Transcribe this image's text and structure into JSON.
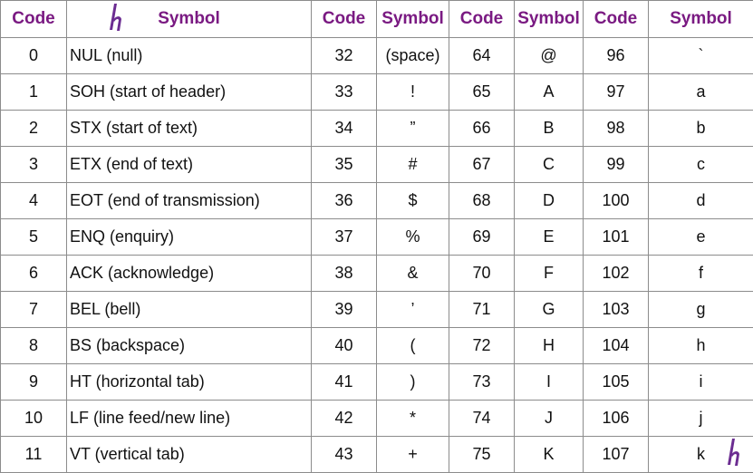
{
  "headers": [
    "Code",
    "Symbol",
    "Code",
    "Symbol",
    "Code",
    "Symbol",
    "Code",
    "Symbol"
  ],
  "rows": [
    [
      "0",
      "NUL (null)",
      "32",
      "(space)",
      "64",
      "@",
      "96",
      "`"
    ],
    [
      "1",
      "SOH (start of header)",
      "33",
      "!",
      "65",
      "A",
      "97",
      "a"
    ],
    [
      "2",
      "STX (start of text)",
      "34",
      "”",
      "66",
      "B",
      "98",
      "b"
    ],
    [
      "3",
      "ETX (end of text)",
      "35",
      "#",
      "67",
      "C",
      "99",
      "c"
    ],
    [
      "4",
      "EOT (end of transmission)",
      "36",
      "$",
      "68",
      "D",
      "100",
      "d"
    ],
    [
      "5",
      "ENQ (enquiry)",
      "37",
      "%",
      "69",
      "E",
      "101",
      "e"
    ],
    [
      "6",
      "ACK (acknowledge)",
      "38",
      "&",
      "70",
      "F",
      "102",
      "f"
    ],
    [
      "7",
      "BEL (bell)",
      "39",
      "’",
      "71",
      "G",
      "103",
      "g"
    ],
    [
      "8",
      "BS (backspace)",
      "40",
      "(",
      "72",
      "H",
      "104",
      "h"
    ],
    [
      "9",
      "HT (horizontal tab)",
      "41",
      ")",
      "73",
      "I",
      "105",
      "i"
    ],
    [
      "10",
      "LF (line feed/new line)",
      "42",
      "*",
      "74",
      "J",
      "106",
      "j"
    ],
    [
      "11",
      "VT (vertical tab)",
      "43",
      "+",
      "75",
      "K",
      "107",
      "k"
    ]
  ],
  "colors": {
    "header_text": "#7a1a82",
    "border": "#8c8c8c",
    "logo": "#6b2c91"
  },
  "icons": {
    "logo": "brand-h-logo-icon"
  }
}
